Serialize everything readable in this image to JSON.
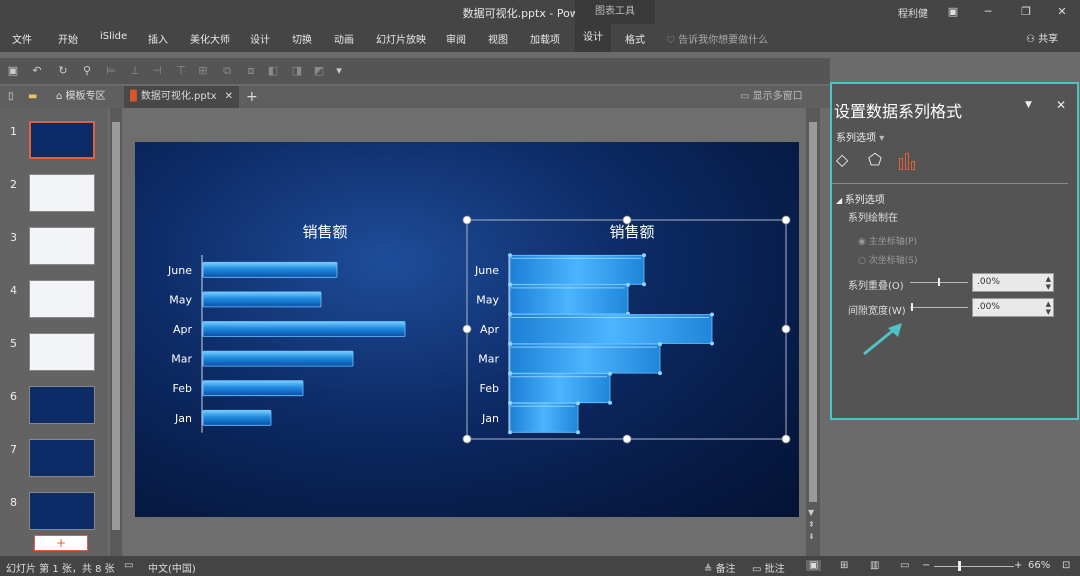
{
  "window": {
    "title": "数据可视化.pptx  -  PowerPoint",
    "tool_tab": "图表工具",
    "user": "程利健"
  },
  "ribbon": {
    "tabs": [
      "文件",
      "开始",
      "iSlide",
      "插入",
      "美化大师",
      "设计",
      "切换",
      "动画",
      "幻灯片放映",
      "审阅",
      "视图",
      "加载项",
      "设计",
      "格式"
    ],
    "selected_tab": "设计",
    "tell_me": "告诉我你想要做什么",
    "share": "共享"
  },
  "doc_tabs": {
    "template": "模板专区",
    "file": "数据可视化.pptx",
    "multi_window": "显示多窗口"
  },
  "thumbnails": [
    "1",
    "2",
    "3",
    "4",
    "5",
    "6",
    "7",
    "8"
  ],
  "add_slide": "+",
  "chart_data": [
    {
      "type": "bar",
      "title": "销售额",
      "categories": [
        "June",
        "May",
        "Apr",
        "Mar",
        "Feb",
        "Jan"
      ],
      "values": [
        67,
        59,
        101,
        75,
        50,
        34
      ],
      "xlim": [
        0,
        110
      ]
    },
    {
      "type": "bar",
      "title": "销售额",
      "categories": [
        "June",
        "May",
        "Apr",
        "Mar",
        "Feb",
        "Jan"
      ],
      "values": [
        67,
        59,
        101,
        75,
        50,
        34
      ],
      "xlim": [
        0,
        110
      ]
    }
  ],
  "format_pane": {
    "title": "设置数据系列格式",
    "options_dropdown": "系列选项",
    "section": "系列选项",
    "plot_on": "系列绘制在",
    "primary_axis": "主坐标轴(P)",
    "secondary_axis": "次坐标轴(S)",
    "overlap_label": "系列重叠(O)",
    "overlap_value": ".00%",
    "gap_label": "间隙宽度(W)",
    "gap_value": ".00%",
    "accent": "#4fc3c8"
  },
  "statusbar": {
    "slide_info": "幻灯片 第 1 张，共 8 张",
    "language": "中文(中国)",
    "notes": "备注",
    "comments": "批注",
    "zoom": "66%"
  }
}
